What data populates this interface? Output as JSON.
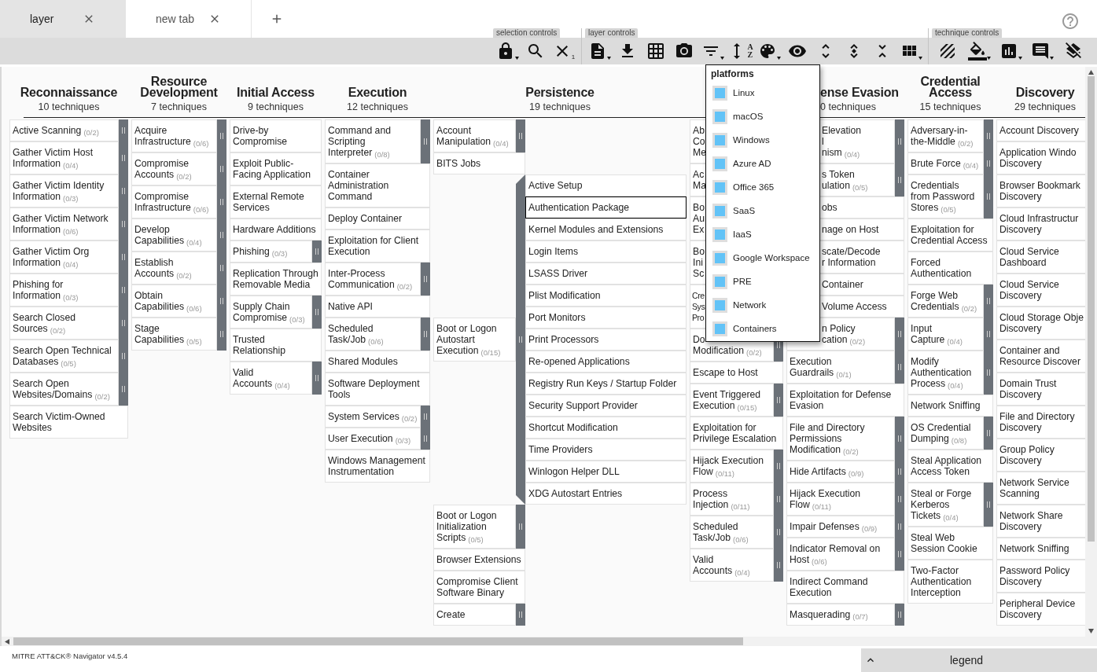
{
  "tabs": [
    {
      "label": "layer",
      "selected": true
    },
    {
      "label": "new tab",
      "selected": false
    }
  ],
  "toolbar": {
    "groups": [
      {
        "label": "selection controls"
      },
      {
        "label": "layer controls"
      },
      {
        "label": "technique controls"
      }
    ],
    "selection_count": "1",
    "sort_letters": [
      "A",
      "Z"
    ]
  },
  "platform_menu": {
    "title": "platforms",
    "items": [
      {
        "label": "Linux",
        "checked": true
      },
      {
        "label": "macOS",
        "checked": true
      },
      {
        "label": "Windows",
        "checked": true
      },
      {
        "label": "Azure AD",
        "checked": true
      },
      {
        "label": "Office 365",
        "checked": true
      },
      {
        "label": "SaaS",
        "checked": true
      },
      {
        "label": "IaaS",
        "checked": true
      },
      {
        "label": "Google Workspace",
        "checked": true
      },
      {
        "label": "PRE",
        "checked": true
      },
      {
        "label": "Network",
        "checked": true
      },
      {
        "label": "Containers",
        "checked": true
      }
    ]
  },
  "matrix": {
    "tactics": [
      {
        "name": "Reconnaissance",
        "count": "10 techniques",
        "techniques": [
          {
            "name": "Active Scanning",
            "count": "(0/2)",
            "kind": "collapsed"
          },
          {
            "name": "Gather Victim Host Information",
            "count": "(0/4)",
            "kind": "collapsed"
          },
          {
            "name": "Gather Victim Identity Information",
            "count": "(0/3)",
            "kind": "collapsed"
          },
          {
            "name": "Gather Victim Network Information",
            "count": "(0/6)",
            "kind": "collapsed"
          },
          {
            "name": "Gather Victim Org Information",
            "count": "(0/4)",
            "kind": "collapsed"
          },
          {
            "name": "Phishing for Information",
            "count": "(0/3)",
            "kind": "collapsed"
          },
          {
            "name": "Search Closed Sources",
            "count": "(0/2)",
            "kind": "collapsed"
          },
          {
            "name": "Search Open Technical Databases",
            "count": "(0/5)",
            "kind": "collapsed"
          },
          {
            "name": "Search Open Websites/Domains",
            "count": "(0/2)",
            "kind": "collapsed"
          },
          {
            "name": "Search Victim-Owned Websites",
            "kind": "plain"
          }
        ]
      },
      {
        "name": "Resource Development",
        "count": "7 techniques",
        "techniques": [
          {
            "name": "Acquire Infrastructure",
            "count": "(0/6)",
            "kind": "collapsed"
          },
          {
            "name": "Compromise Accounts",
            "count": "(0/2)",
            "kind": "collapsed"
          },
          {
            "name": "Compromise Infrastructure",
            "count": "(0/6)",
            "kind": "collapsed"
          },
          {
            "name": "Develop Capabilities",
            "count": "(0/4)",
            "kind": "collapsed"
          },
          {
            "name": "Establish Accounts",
            "count": "(0/2)",
            "kind": "collapsed"
          },
          {
            "name": "Obtain Capabilities",
            "count": "(0/6)",
            "kind": "collapsed"
          },
          {
            "name": "Stage Capabilities",
            "count": "(0/5)",
            "kind": "collapsed"
          }
        ]
      },
      {
        "name": "Initial Access",
        "count": "9 techniques",
        "techniques": [
          {
            "name": "Drive-by Compromise",
            "kind": "plain"
          },
          {
            "name": "Exploit Public-Facing Application",
            "kind": "plain"
          },
          {
            "name": "External Remote Services",
            "kind": "plain"
          },
          {
            "name": "Hardware Additions",
            "kind": "plain"
          },
          {
            "name": "Phishing",
            "count": "(0/3)",
            "kind": "collapsed"
          },
          {
            "name": "Replication Through Removable Media",
            "kind": "plain"
          },
          {
            "name": "Supply Chain Compromise",
            "count": "(0/3)",
            "kind": "collapsed"
          },
          {
            "name": "Trusted Relationship",
            "kind": "plain"
          },
          {
            "name": "Valid Accounts",
            "count": "(0/4)",
            "kind": "collapsed"
          }
        ]
      },
      {
        "name": "Execution",
        "count": "12 techniques",
        "techniques": [
          {
            "name": "Command and Scripting Interpreter",
            "count": "(0/8)",
            "kind": "collapsed"
          },
          {
            "name": "Container Administration Command",
            "kind": "plain"
          },
          {
            "name": "Deploy Container",
            "kind": "plain"
          },
          {
            "name": "Exploitation for Client Execution",
            "kind": "plain"
          },
          {
            "name": "Inter-Process Communication",
            "count": "(0/2)",
            "kind": "collapsed"
          },
          {
            "name": "Native API",
            "kind": "plain"
          },
          {
            "name": "Scheduled Task/Job",
            "count": "(0/6)",
            "kind": "collapsed"
          },
          {
            "name": "Shared Modules",
            "kind": "plain"
          },
          {
            "name": "Software Deployment Tools",
            "kind": "plain"
          },
          {
            "name": "System Services",
            "count": "(0/2)",
            "kind": "collapsed"
          },
          {
            "name": "User Execution",
            "count": "(0/3)",
            "kind": "collapsed"
          },
          {
            "name": "Windows Management Instrumentation",
            "kind": "plain"
          }
        ]
      },
      {
        "name": "Persistence",
        "count": "19 techniques",
        "techniques": [
          {
            "name": "Account Manipulation",
            "count": "(0/4)",
            "kind": "collapsed"
          },
          {
            "name": "BITS Jobs",
            "kind": "plain"
          },
          {
            "name": "Boot or Logon Autostart Execution",
            "count": "(0/15)",
            "kind": "expanded",
            "subtechniques": [
              {
                "name": "Active Setup",
                "selected": false
              },
              {
                "name": "Authentication Package",
                "selected": true
              },
              {
                "name": "Kernel Modules and Extensions",
                "selected": false
              },
              {
                "name": "Login Items",
                "selected": false
              },
              {
                "name": "LSASS Driver",
                "selected": false
              },
              {
                "name": "Plist Modification",
                "selected": false
              },
              {
                "name": "Port Monitors",
                "selected": false
              },
              {
                "name": "Print Processors",
                "selected": false
              },
              {
                "name": "Re-opened Applications",
                "selected": false
              },
              {
                "name": "Registry Run Keys / Startup Folder",
                "selected": false
              },
              {
                "name": "Security Support Provider",
                "selected": false
              },
              {
                "name": "Shortcut Modification",
                "selected": false
              },
              {
                "name": "Time Providers",
                "selected": false
              },
              {
                "name": "Winlogon Helper DLL",
                "selected": false
              },
              {
                "name": "XDG Autostart Entries",
                "selected": false
              }
            ]
          },
          {
            "name": "Boot or Logon Initialization Scripts",
            "count": "(0/5)",
            "kind": "collapsed"
          },
          {
            "name": "Browser Extensions",
            "kind": "plain"
          },
          {
            "name": "Compromise Client Software Binary",
            "kind": "plain"
          },
          {
            "name": "Create",
            "kind": "collapsed"
          }
        ]
      },
      {
        "techniques": [
          {
            "name": "Ab\nCo\nMe",
            "kind": "plain"
          },
          {
            "name": "Ac\nMa",
            "kind": "plain"
          },
          {
            "name": "Bo\nAu\nEx",
            "kind": "plain"
          },
          {
            "name": "Bo\nIni\nSc",
            "kind": "plain"
          },
          {
            "name": "Cre\nSys\nPro",
            "kind": "collapsed",
            "clipped_right": true
          },
          {
            "name": "Do\nModification",
            "count": "(0/2)",
            "kind": "collapsed"
          },
          {
            "name": "Escape to Host",
            "kind": "plain"
          },
          {
            "name": "Event Triggered Execution",
            "count": "(0/15)",
            "kind": "collapsed"
          },
          {
            "name": "Exploitation for Privilege Escalation",
            "kind": "plain"
          },
          {
            "name": "Hijack Execution Flow",
            "count": "(0/11)",
            "kind": "collapsed"
          },
          {
            "name": "Process Injection",
            "count": "(0/11)",
            "kind": "collapsed"
          },
          {
            "name": "Scheduled Task/Job",
            "count": "(0/6)",
            "kind": "collapsed"
          },
          {
            "name": "Valid Accounts",
            "count": "(0/4)",
            "kind": "collapsed"
          }
        ]
      },
      {
        "name": "ense Evasion",
        "count": "0 techniques",
        "clipped_left": true,
        "techniques": [
          {
            "name": "Elevation\nl\nnism",
            "count": "(0/4)",
            "kind": "collapsed",
            "clipped_left": true
          },
          {
            "name": "s Token\nulation",
            "count": "(0/5)",
            "kind": "collapsed",
            "clipped_left": true
          },
          {
            "name": "obs",
            "kind": "plain",
            "clipped_left": true
          },
          {
            "name": "nage on Host",
            "kind": "plain",
            "clipped_left": true
          },
          {
            "name": "scate/Decode\nr Information",
            "kind": "plain",
            "clipped_left": true
          },
          {
            "name": "Container",
            "kind": "plain",
            "clipped_left": true
          },
          {
            "name": "Volume Access",
            "kind": "plain",
            "clipped_left": true
          },
          {
            "name": "n Policy\ncation",
            "count": "(0/2)",
            "kind": "collapsed",
            "clipped_left": true
          },
          {
            "name": "Execution Guardrails",
            "count": "(0/1)",
            "kind": "collapsed"
          },
          {
            "name": "Exploitation for Defense Evasion",
            "kind": "plain"
          },
          {
            "name": "File and Directory Permissions Modification",
            "count": "(0/2)",
            "kind": "collapsed"
          },
          {
            "name": "Hide Artifacts",
            "count": "(0/9)",
            "kind": "collapsed"
          },
          {
            "name": "Hijack Execution Flow",
            "count": "(0/11)",
            "kind": "collapsed"
          },
          {
            "name": "Impair Defenses",
            "count": "(0/9)",
            "kind": "collapsed"
          },
          {
            "name": "Indicator Removal on Host",
            "count": "(0/6)",
            "kind": "collapsed"
          },
          {
            "name": "Indirect Command Execution",
            "kind": "plain"
          },
          {
            "name": "Masquerading",
            "count": "(0/7)",
            "kind": "collapsed"
          }
        ]
      },
      {
        "name": "Credential Access",
        "count": "15 techniques",
        "techniques": [
          {
            "name": "Adversary-in-the-Middle",
            "count": "(0/2)",
            "kind": "collapsed"
          },
          {
            "name": "Brute Force",
            "count": "(0/4)",
            "kind": "collapsed"
          },
          {
            "name": "Credentials from Password Stores",
            "count": "(0/5)",
            "kind": "collapsed"
          },
          {
            "name": "Exploitation for Credential Access",
            "kind": "plain"
          },
          {
            "name": "Forced Authentication",
            "kind": "plain"
          },
          {
            "name": "Forge Web Credentials",
            "count": "(0/2)",
            "kind": "collapsed"
          },
          {
            "name": "Input Capture",
            "count": "(0/4)",
            "kind": "collapsed"
          },
          {
            "name": "Modify Authentication Process",
            "count": "(0/4)",
            "kind": "collapsed"
          },
          {
            "name": "Network Sniffing",
            "kind": "plain"
          },
          {
            "name": "OS Credential Dumping",
            "count": "(0/8)",
            "kind": "collapsed"
          },
          {
            "name": "Steal Application Access Token",
            "kind": "plain"
          },
          {
            "name": "Steal or Forge Kerberos Tickets",
            "count": "(0/4)",
            "kind": "collapsed"
          },
          {
            "name": "Steal Web Session Cookie",
            "kind": "plain"
          },
          {
            "name": "Two-Factor Authentication Interception",
            "kind": "plain"
          }
        ]
      },
      {
        "name": "Discovery",
        "count": "29 techniques",
        "techniques": [
          {
            "name": "Account Discovery",
            "kind": "plain"
          },
          {
            "name": "Application Windo\nDiscovery",
            "kind": "plain"
          },
          {
            "name": "Browser Bookmark\nDiscovery",
            "kind": "plain"
          },
          {
            "name": "Cloud Infrastructur\nDiscovery",
            "kind": "plain"
          },
          {
            "name": "Cloud Service Dashboard",
            "kind": "plain"
          },
          {
            "name": "Cloud Service Discovery",
            "kind": "plain"
          },
          {
            "name": "Cloud Storage Obje\nDiscovery",
            "kind": "plain"
          },
          {
            "name": "Container and\nResource Discover",
            "kind": "plain"
          },
          {
            "name": "Domain Trust Discovery",
            "kind": "plain"
          },
          {
            "name": "File and Directory Discovery",
            "kind": "plain"
          },
          {
            "name": "Group Policy Discovery",
            "kind": "plain"
          },
          {
            "name": "Network Service Scanning",
            "kind": "plain"
          },
          {
            "name": "Network Share Discovery",
            "kind": "plain"
          },
          {
            "name": "Network Sniffing",
            "kind": "plain"
          },
          {
            "name": "Password Policy Discovery",
            "kind": "plain"
          },
          {
            "name": "Peripheral Device Discovery",
            "kind": "plain"
          }
        ]
      }
    ]
  },
  "footer": {
    "version": "MITRE ATT&CK® Navigator v4.5.4"
  },
  "legend": {
    "label": "legend"
  }
}
